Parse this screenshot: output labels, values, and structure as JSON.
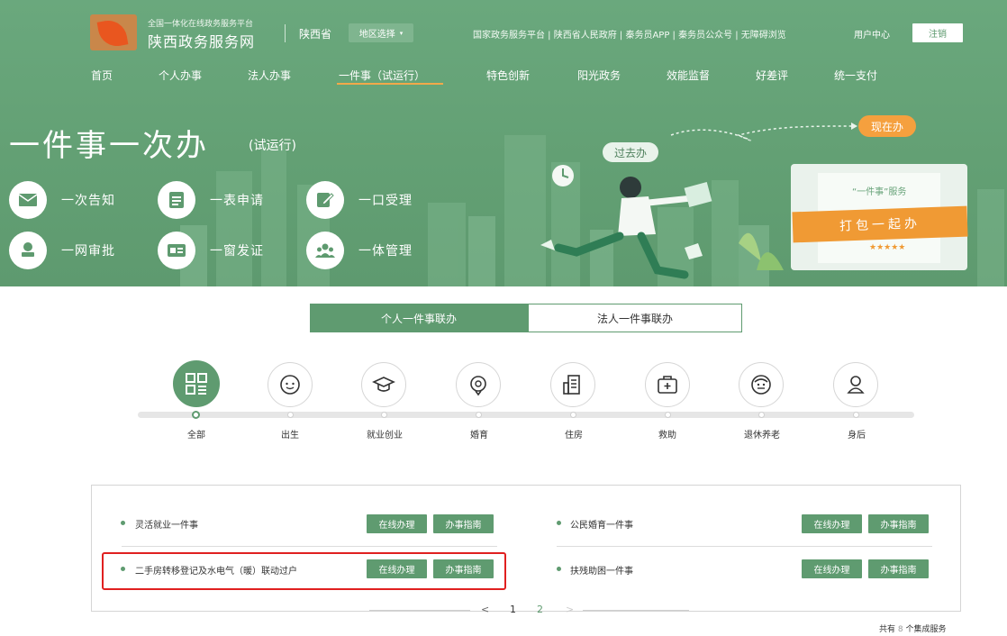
{
  "header": {
    "logo_small": "全国一体化在线政务服务平台",
    "logo_big": "陕西政务服务网",
    "province": "陕西省",
    "region_select": "地区选择",
    "top_links": "国家政务服务平台 | 陕西省人民政府 | 秦务员APP | 秦务员公众号 | 无障碍浏览",
    "user_center": "用户中心",
    "logout": "注销"
  },
  "nav": {
    "items": [
      "首页",
      "个人办事",
      "法人办事",
      "一件事（试运行）",
      "特色创新",
      "阳光政务",
      "效能监督",
      "好差评",
      "统一支付"
    ],
    "active_index": 3
  },
  "banner": {
    "title": "一件事一次办",
    "subtitle": "(试运行)",
    "features": [
      "一次告知",
      "一表申请",
      "一口受理",
      "一网审批",
      "一窗发证",
      "一体管理"
    ],
    "past_label": "过去办",
    "now_label": "现在办",
    "board_title": "“一件事”服务",
    "ribbon_text": "打包一起办",
    "stars": "★★★★★"
  },
  "tabs": {
    "personal": "个人一件事联办",
    "legal": "法人一件事联办",
    "active": "personal"
  },
  "categories": {
    "items": [
      "全部",
      "出生",
      "就业创业",
      "婚育",
      "住房",
      "救助",
      "退休养老",
      "身后"
    ],
    "icons": [
      "grid-icon",
      "baby-icon",
      "graduation-cap-icon",
      "ring-icon",
      "building-icon",
      "first-aid-icon",
      "elderly-icon",
      "person-outline-icon"
    ],
    "active_index": 0
  },
  "services": {
    "online_label": "在线办理",
    "guide_label": "办事指南",
    "items": [
      {
        "name": "灵活就业一件事"
      },
      {
        "name": "公民婚育一件事"
      },
      {
        "name": "二手房转移登记及水电气（暖）联动过户"
      },
      {
        "name": "扶残助困一件事"
      }
    ]
  },
  "pagination": {
    "prev": "<",
    "pages": [
      "1",
      "2"
    ],
    "next": ">",
    "current": "1"
  },
  "total": {
    "prefix": "共有",
    "count": "8",
    "suffix": "个集成服务"
  },
  "colors": {
    "brand_green": "#5f9b70",
    "accent_orange": "#f5a03e",
    "highlight_red": "#e02020"
  }
}
